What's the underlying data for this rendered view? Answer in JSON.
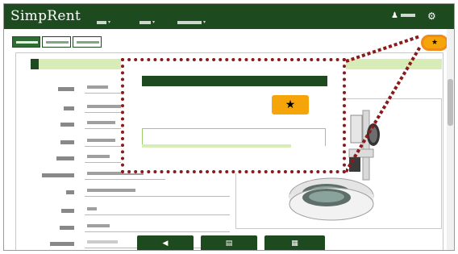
{
  "app": {
    "logo": "SimpRent",
    "user_icon": "person-icon",
    "settings_icon": "gear-icon",
    "favorite_icon": "star-icon",
    "favorite_glyph": "★",
    "zoom_favorite_glyph": "★"
  },
  "colors": {
    "navbar": "#1d4a1f",
    "accent_green": "#2f6b32",
    "light_green": "#d8ecb8",
    "favorite_orange": "#f5a50a",
    "highlight_circle": "#f08a18",
    "zoom_border": "#8b1a1a"
  },
  "nav": {
    "caret": "▾",
    "user_glyph": "♟",
    "gear_glyph": "⚙"
  },
  "bottom_buttons": {
    "prev_icon": "chevron-left-icon",
    "prev_glyph": "◀",
    "list_icon": "list-icon",
    "list_glyph": "▤",
    "calendar_icon": "calendar-icon",
    "calendar_glyph": "▦"
  }
}
